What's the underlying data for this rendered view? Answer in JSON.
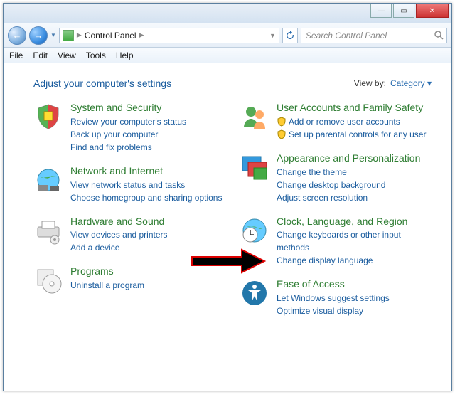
{
  "titlebar": {
    "min": "—",
    "max": "▭",
    "close": "✕"
  },
  "nav": {
    "back": "←",
    "fwd": "→",
    "breadcrumb_label": "Control Panel",
    "search_placeholder": "Search Control Panel"
  },
  "menu": {
    "file": "File",
    "edit": "Edit",
    "view": "View",
    "tools": "Tools",
    "help": "Help"
  },
  "header": {
    "title": "Adjust your computer's settings",
    "viewby_label": "View by:",
    "viewby_value": "Category"
  },
  "left": [
    {
      "title": "System and Security",
      "links": [
        "Review your computer's status",
        "Back up your computer",
        "Find and fix problems"
      ]
    },
    {
      "title": "Network and Internet",
      "links": [
        "View network status and tasks",
        "Choose homegroup and sharing options"
      ]
    },
    {
      "title": "Hardware and Sound",
      "links": [
        "View devices and printers",
        "Add a device"
      ]
    },
    {
      "title": "Programs",
      "links": [
        "Uninstall a program"
      ]
    }
  ],
  "right": [
    {
      "title": "User Accounts and Family Safety",
      "links": [
        "Add or remove user accounts",
        "Set up parental controls for any user"
      ],
      "shielded": true
    },
    {
      "title": "Appearance and Personalization",
      "links": [
        "Change the theme",
        "Change desktop background",
        "Adjust screen resolution"
      ]
    },
    {
      "title": "Clock, Language, and Region",
      "links": [
        "Change keyboards or other input methods",
        "Change display language"
      ]
    },
    {
      "title": "Ease of Access",
      "links": [
        "Let Windows suggest settings",
        "Optimize visual display"
      ]
    }
  ]
}
